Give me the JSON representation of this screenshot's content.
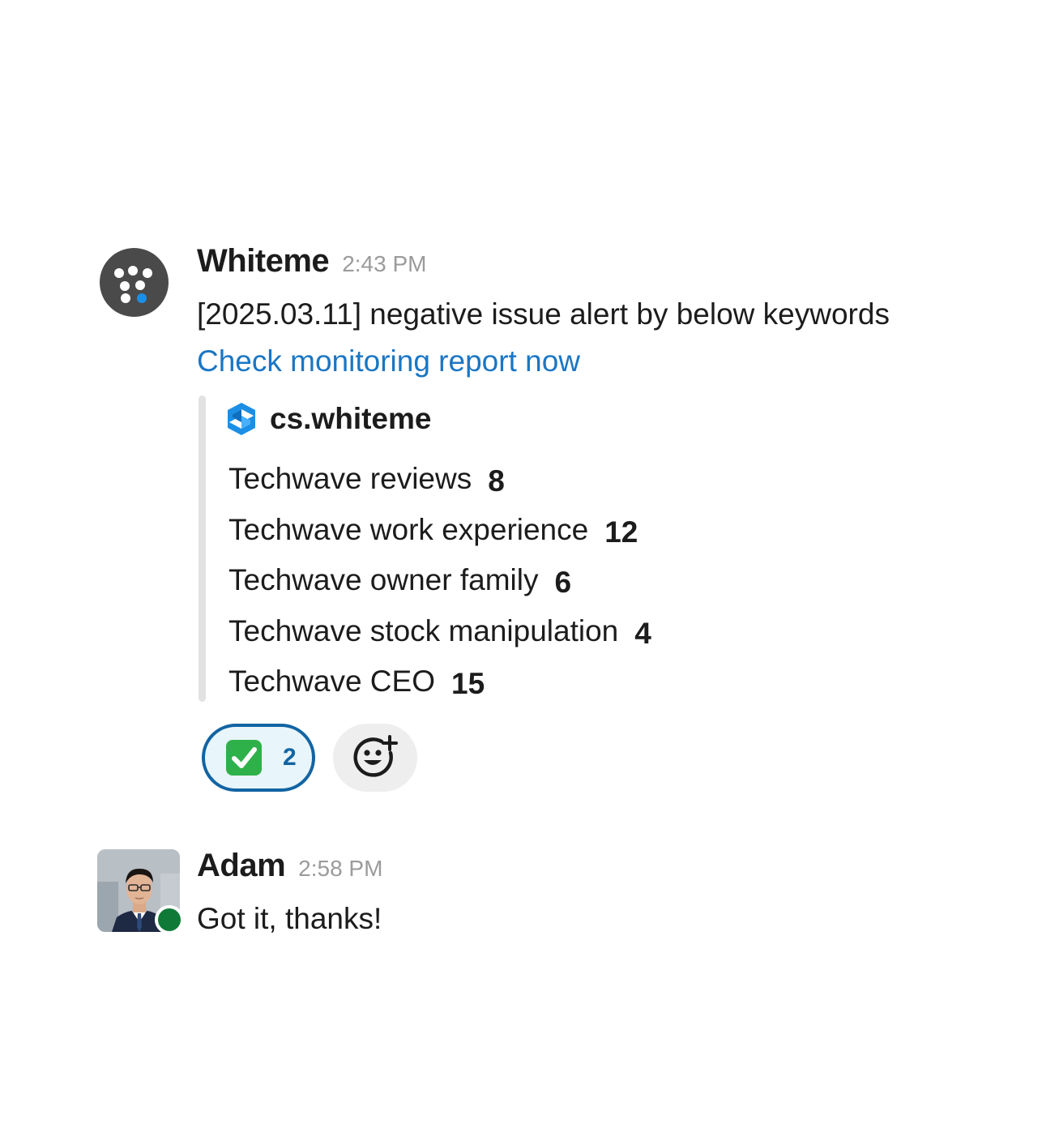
{
  "messages": [
    {
      "author": "Whiteme",
      "time": "2:43 PM",
      "text": "[2025.03.11] negative issue alert by below keywords",
      "link_text": "Check monitoring report now",
      "avatar_icon": "whiteme-logo-icon",
      "attachment": {
        "source": "cs.whiteme",
        "source_icon": "cs-whiteme-logo-icon",
        "keywords": [
          {
            "label": "Techwave reviews",
            "count": "8"
          },
          {
            "label": "Techwave work experience",
            "count": "12"
          },
          {
            "label": "Techwave owner family",
            "count": "6"
          },
          {
            "label": "Techwave stock manipulation",
            "count": "4"
          },
          {
            "label": "Techwave CEO",
            "count": "15"
          }
        ]
      },
      "reactions": [
        {
          "emoji": "white-check-mark-icon",
          "count": "2"
        }
      ],
      "add_reaction_icon": "add-reaction-icon"
    },
    {
      "author": "Adam",
      "time": "2:58 PM",
      "text": "Got it, thanks!",
      "avatar": "user-photo",
      "status": "online"
    }
  ],
  "colors": {
    "link": "#1a76c4",
    "reaction_border": "#1264a3",
    "reaction_bg": "#e8f5fa",
    "online": "#0f7a37",
    "accent_blue": "#1b8fe6"
  }
}
